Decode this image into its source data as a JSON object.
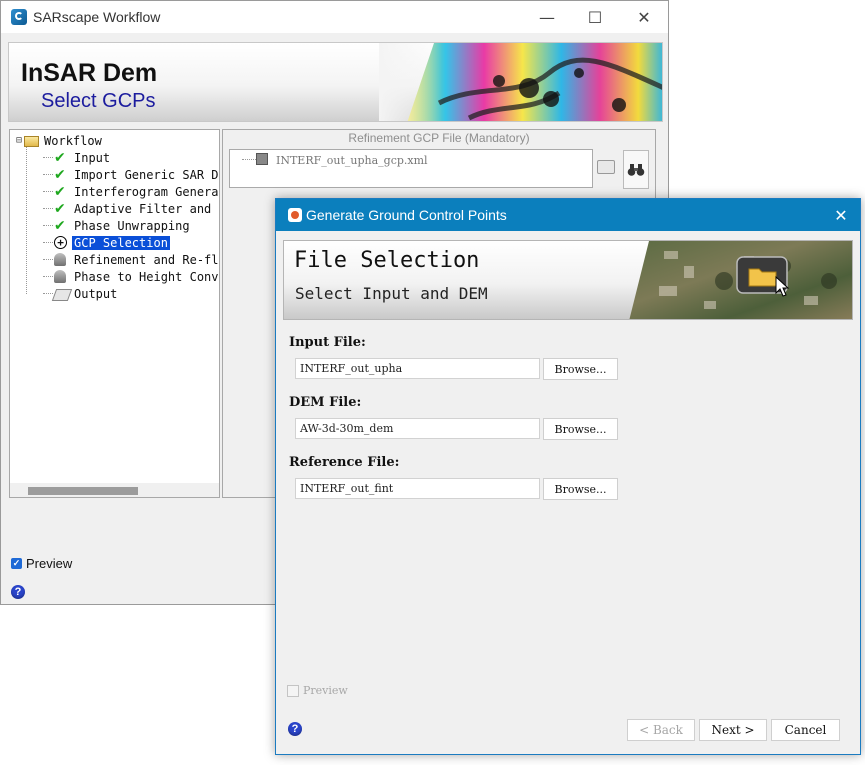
{
  "main_window": {
    "title": "SARscape Workflow",
    "controls": {
      "minimize": "—",
      "maximize": "☐",
      "close": "✕"
    },
    "banner": {
      "title": "InSAR Dem",
      "subtitle": "Select GCPs"
    },
    "tree": {
      "root": "Workflow",
      "items": [
        {
          "label": "Input",
          "icon": "check-icon"
        },
        {
          "label": "Import Generic SAR Data",
          "icon": "check-icon"
        },
        {
          "label": "Interferogram Generation",
          "icon": "check-icon"
        },
        {
          "label": "Adaptive Filter and Coherence",
          "icon": "check-icon"
        },
        {
          "label": "Phase Unwrapping",
          "icon": "check-icon"
        },
        {
          "label": "GCP Selection",
          "icon": "gcp-icon",
          "selected": true
        },
        {
          "label": "Refinement and Re-flattening",
          "icon": "drop-icon"
        },
        {
          "label": "Phase to Height Conversion",
          "icon": "drop-icon"
        },
        {
          "label": "Output",
          "icon": "output-icon"
        }
      ]
    },
    "refinement": {
      "label": "Refinement GCP File (Mandatory)",
      "file": "INTERF_out_upha_gcp.xml"
    },
    "preview_label": "Preview",
    "preview_checked": true,
    "help": "?"
  },
  "dialog": {
    "title": "Generate Ground Control Points",
    "close": "✕",
    "banner": {
      "title": "File Selection",
      "subtitle": "Select Input and DEM"
    },
    "fields": [
      {
        "label": "Input File:",
        "value": "INTERF_out_upha",
        "button": "Browse..."
      },
      {
        "label": "DEM File:",
        "value": "AW-3d-30m_dem",
        "button": "Browse..."
      },
      {
        "label": "Reference File:",
        "value": "INTERF_out_fint",
        "button": "Browse..."
      }
    ],
    "preview_label": "Preview",
    "preview_checked": false,
    "help": "?",
    "buttons": {
      "back": "< Back",
      "next": "Next >",
      "cancel": "Cancel"
    }
  },
  "colors": {
    "dialog_titlebar": "#0b7fbd",
    "tree_selection": "#0a4fd8",
    "banner_subtitle": "#1c1c9e",
    "check": "#1fa81f"
  }
}
